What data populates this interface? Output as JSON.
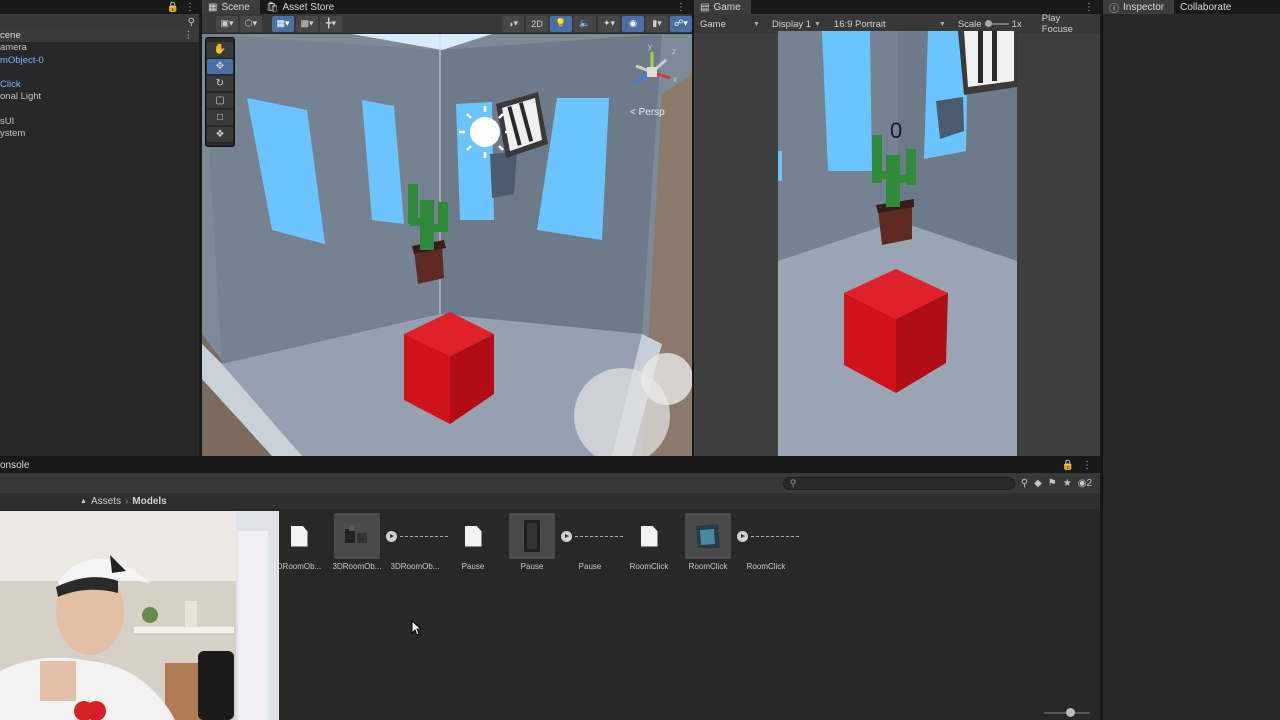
{
  "hierarchy": {
    "scene_name": "cene",
    "items": [
      "amera",
      "mObject-0",
      "",
      "Click",
      "onal Light",
      "",
      "sUI",
      "ystem"
    ]
  },
  "scene": {
    "tabs": [
      "Scene",
      "Asset Store"
    ],
    "mode_2d": "2D",
    "persp_label": "< Persp",
    "gizmo_axes": [
      "y",
      "x",
      "z"
    ]
  },
  "game": {
    "tab": "Game",
    "dropdown_game": "Game",
    "display": "Display 1",
    "aspect": "16:9 Portrait",
    "scale_label": "Scale",
    "scale_value": "1x",
    "play_focused": "Play Focuse",
    "score": "0"
  },
  "inspector": {
    "tabs": [
      "Inspector",
      "Collaborate"
    ]
  },
  "project": {
    "tab": "onsole",
    "breadcrumb": [
      "Assets",
      "Models"
    ],
    "hidden_count": "2",
    "assets": [
      {
        "label": "DRoomOb...",
        "kind": "doc"
      },
      {
        "label": "3DRoomOb...",
        "kind": "model"
      },
      {
        "label": "3DRoomOb...",
        "kind": "anim"
      },
      {
        "label": "Pause",
        "kind": "doc"
      },
      {
        "label": "Pause",
        "kind": "model"
      },
      {
        "label": "Pause",
        "kind": "anim"
      },
      {
        "label": "RoomClick",
        "kind": "doc"
      },
      {
        "label": "RoomClick",
        "kind": "model"
      },
      {
        "label": "RoomClick",
        "kind": "anim"
      }
    ]
  },
  "colors": {
    "accent": "#4a6fa5",
    "cube": "#d1121b",
    "window": "#6cc4ff",
    "wall": "#7a8796",
    "floor": "#9aa5b3"
  }
}
